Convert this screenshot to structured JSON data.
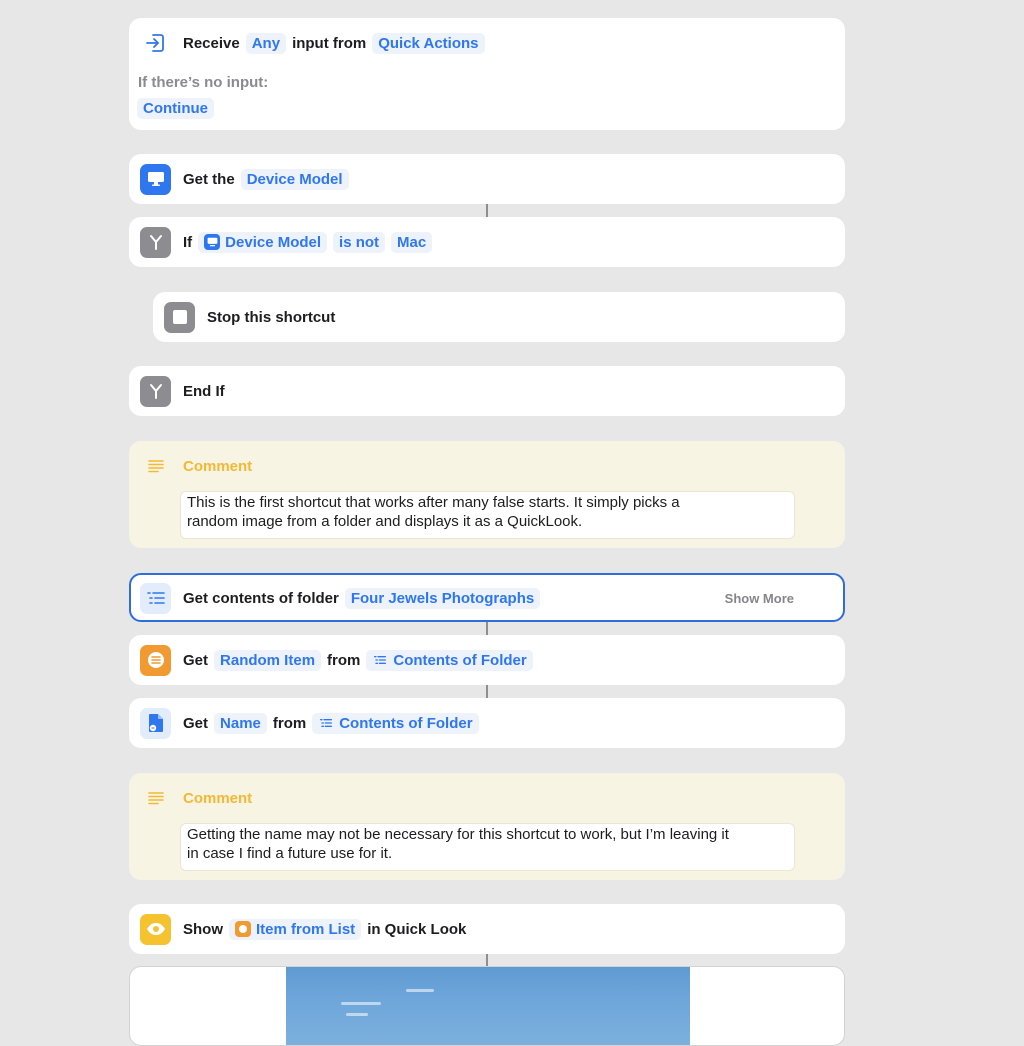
{
  "receive": {
    "label": "Receive",
    "type_token": "Any",
    "middle": "input from",
    "source_token": "Quick Actions",
    "no_input_label": "If there’s no input:",
    "no_input_action": "Continue"
  },
  "get_device": {
    "label": "Get the",
    "token": "Device Model"
  },
  "if_block": {
    "label": "If",
    "variable": "Device Model",
    "condition": "is not",
    "value": "Mac"
  },
  "stop": {
    "label": "Stop this shortcut"
  },
  "end_if": {
    "label": "End If"
  },
  "comment1": {
    "title": "Comment",
    "line1": "This is the first shortcut that works after many false starts.  It simply picks a",
    "line2": "random image from a folder and displays it as a QuickLook."
  },
  "get_folder": {
    "label": "Get contents of folder",
    "token": "Four Jewels Photographs",
    "show_more": "Show More"
  },
  "get_random": {
    "label": "Get",
    "token": "Random Item",
    "middle": "from",
    "source": "Contents of Folder"
  },
  "get_name": {
    "label": "Get",
    "token": "Name",
    "middle": "from",
    "source": "Contents of Folder"
  },
  "comment2": {
    "title": "Comment",
    "line1": "Getting the name may not be necessary for this shortcut to work, but I’m leaving it",
    "line2": "in case I find a future use for it."
  },
  "show": {
    "label": "Show",
    "token": "Item from List",
    "suffix": "in Quick Look"
  },
  "colors": {
    "accent": "#2f77ee",
    "selection": "#2f6ddb",
    "comment_bg": "#f8f4e4",
    "comment_title": "#f2b935",
    "background": "#e6e7e6"
  },
  "icons": {
    "receive": "input-arrow-icon",
    "device": "monitor-icon",
    "if": "branch-icon",
    "stop": "stop-icon",
    "comment": "lines-icon",
    "folder": "list-icon",
    "random": "list-circle-icon",
    "name": "document-icon",
    "show": "eye-icon"
  }
}
